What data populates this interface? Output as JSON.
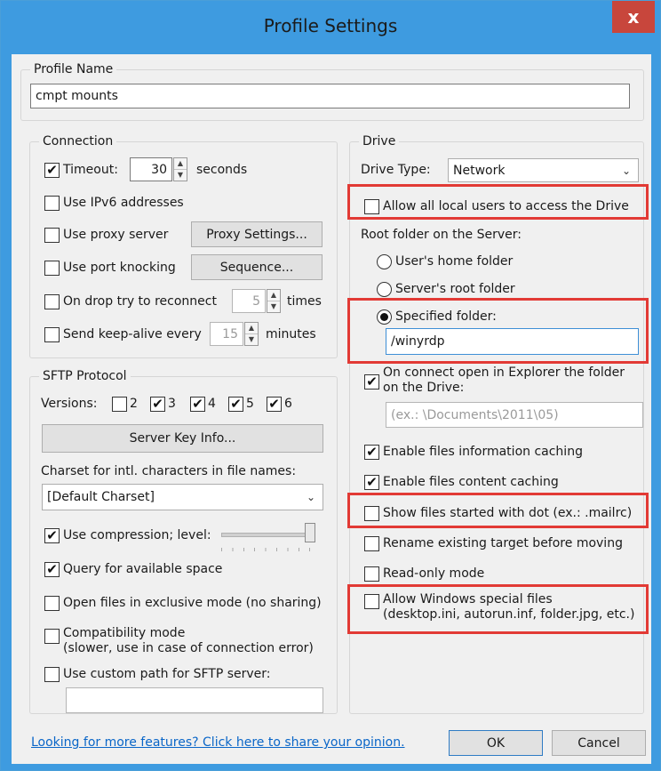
{
  "window": {
    "title": "Profile Settings",
    "close_label": "x"
  },
  "profile": {
    "group_label": "Profile Name",
    "name_value": "cmpt mounts"
  },
  "connection": {
    "group_label": "Connection",
    "timeout": {
      "label": "Timeout:",
      "value": "30",
      "unit": "seconds",
      "checked": true
    },
    "ipv6": {
      "label": "Use IPv6 addresses",
      "checked": false
    },
    "proxy": {
      "label": "Use proxy server",
      "checked": false,
      "button": "Proxy Settings..."
    },
    "port_knocking": {
      "label": "Use port knocking",
      "checked": false,
      "button": "Sequence..."
    },
    "reconnect": {
      "label": "On drop try to reconnect",
      "value": "5",
      "unit": "times",
      "checked": false
    },
    "keepalive": {
      "label": "Send keep-alive every",
      "value": "15",
      "unit": "minutes",
      "checked": false
    }
  },
  "sftp": {
    "group_label": "SFTP Protocol",
    "versions_label": "Versions:",
    "versions": [
      {
        "label": "2",
        "checked": false
      },
      {
        "label": "3",
        "checked": true
      },
      {
        "label": "4",
        "checked": true
      },
      {
        "label": "5",
        "checked": true
      },
      {
        "label": "6",
        "checked": true
      }
    ],
    "server_key_button": "Server Key Info...",
    "charset_label": "Charset for intl. characters in file names:",
    "charset_value": "[Default Charset]",
    "compression": {
      "label": "Use compression; level:",
      "checked": true,
      "level": 1.0
    },
    "query_space": {
      "label": "Query for available space",
      "checked": true
    },
    "exclusive": {
      "label": "Open files in exclusive mode (no sharing)",
      "checked": false
    },
    "compat": {
      "label": "Compatibility mode",
      "sublabel": "(slower, use in case of connection error)",
      "checked": false
    },
    "custom_path": {
      "label": "Use custom path for SFTP server:",
      "checked": false,
      "value": ""
    }
  },
  "drive": {
    "group_label": "Drive",
    "type_label": "Drive Type:",
    "type_value": "Network",
    "allow_local_users": {
      "label": "Allow all local users to access the Drive",
      "checked": false
    },
    "root_label": "Root folder on the Server:",
    "root_options": [
      {
        "label": "User's home folder",
        "selected": false
      },
      {
        "label": "Server's root folder",
        "selected": false
      },
      {
        "label": "Specified folder:",
        "selected": true
      }
    ],
    "specified_folder_value": "/winyrdp",
    "open_explorer": {
      "label": "On connect open in Explorer the folder",
      "sublabel": "on the Drive:",
      "checked": true,
      "placeholder": "(ex.: \\Documents\\2011\\05)"
    },
    "info_caching": {
      "label": "Enable files information caching",
      "checked": true
    },
    "content_caching": {
      "label": "Enable files content caching",
      "checked": true
    },
    "show_dot": {
      "label": "Show files started with dot (ex.: .mailrc)",
      "checked": false
    },
    "rename_target": {
      "label": "Rename existing target before moving",
      "checked": false
    },
    "readonly": {
      "label": "Read-only mode",
      "checked": false
    },
    "windows_special": {
      "label": "Allow Windows special files",
      "sublabel": "(desktop.ini, autorun.inf, folder.jpg, etc.)",
      "checked": false
    }
  },
  "footer": {
    "feedback_link": "Looking for more features? Click here to share your opinion.",
    "ok": "OK",
    "cancel": "Cancel"
  },
  "glyphs": {
    "check": "✔",
    "empty": "",
    "up": "▲",
    "down": "▼",
    "dropdown": "⌄"
  },
  "colors": {
    "titlebar": "#3e9be0",
    "close": "#c8463c",
    "highlight": "#e23a35",
    "link": "#0a66c8"
  }
}
